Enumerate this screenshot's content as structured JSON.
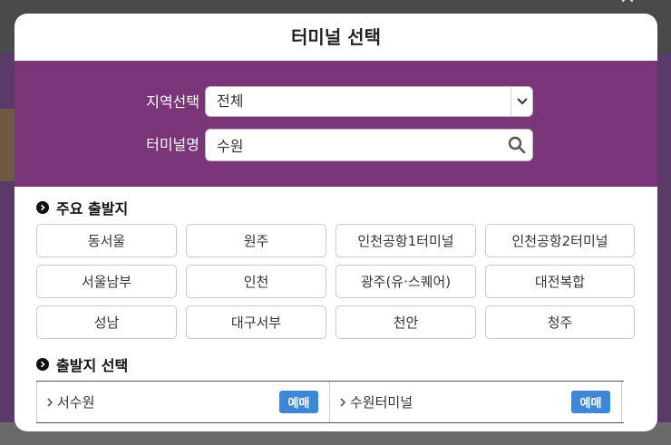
{
  "modal": {
    "title": "터미널 선택"
  },
  "search": {
    "region_label": "지역선택",
    "region_value": "전체",
    "terminal_label": "터미널명",
    "terminal_value": "수원"
  },
  "major_departures": {
    "title": "주요 출발지",
    "items": [
      "동서울",
      "원주",
      "인천공항1터미널",
      "인천공항2터미널",
      "서울남부",
      "인천",
      "광주(유·스퀘어)",
      "대전복합",
      "성남",
      "대구서부",
      "천안",
      "청주"
    ]
  },
  "departure_select": {
    "title": "출발지 선택",
    "results": [
      {
        "name": "서수원",
        "button": "예매"
      },
      {
        "name": "수원터미널",
        "button": "예매"
      }
    ]
  },
  "colors": {
    "panel": "#7a3678",
    "reserve_button": "#3e86d6"
  },
  "icons": [
    "chevron-down-icon",
    "search-icon",
    "bullet-arrow-icon",
    "chevron-right-icon",
    "close-icon"
  ]
}
